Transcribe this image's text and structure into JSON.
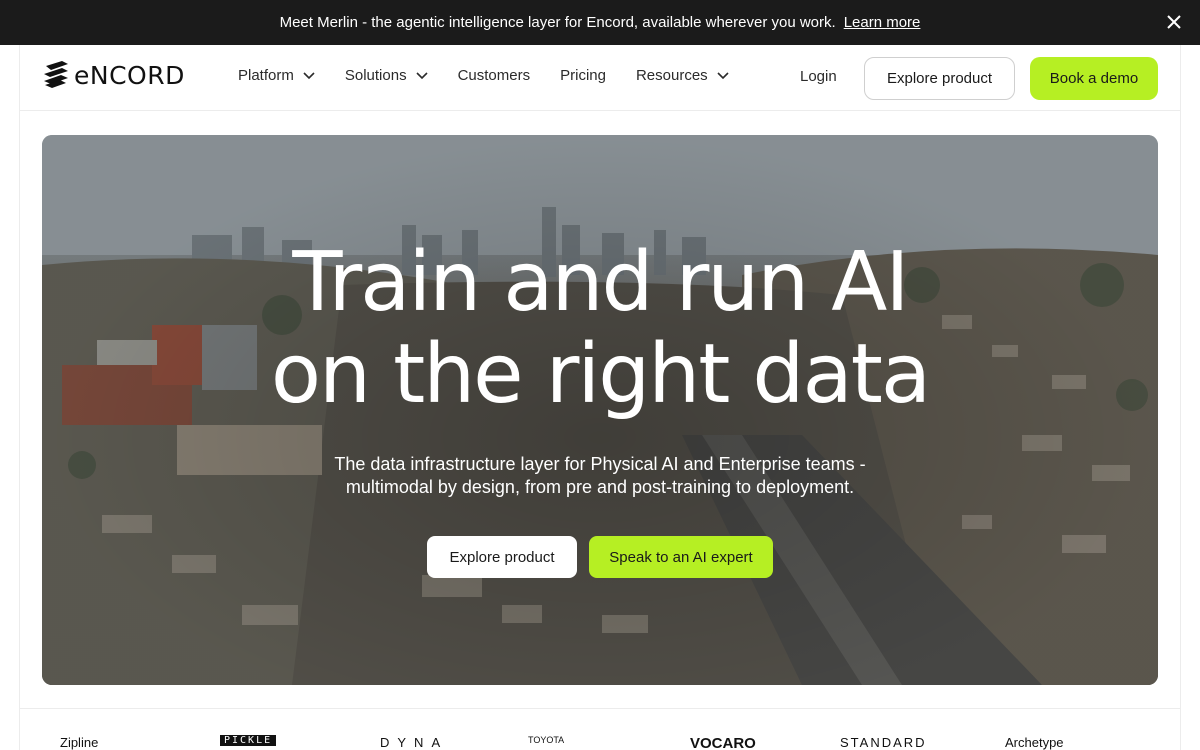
{
  "announcement": {
    "message": "Meet Merlin - the agentic intelligence layer for Encord, available wherever you work.",
    "link": "Learn more"
  },
  "nav": {
    "brand": "eNCORD",
    "menu": [
      {
        "label": "Platform",
        "dropdown": true
      },
      {
        "label": "Solutions",
        "dropdown": true
      },
      {
        "label": "Customers",
        "dropdown": false
      },
      {
        "label": "Pricing",
        "dropdown": false
      },
      {
        "label": "Resources",
        "dropdown": true
      }
    ],
    "login": "Login",
    "explore": "Explore product",
    "demo": "Book a demo"
  },
  "hero": {
    "title_line1": "Train and run AI",
    "title_line2": "on the right data",
    "subtitle_line1": "The data infrastructure layer for Physical AI and Enterprise teams -",
    "subtitle_line2": "multimodal by design, from pre and post-training to deployment.",
    "cta_primary": "Explore product",
    "cta_secondary": "Speak to an AI expert"
  },
  "logos": [
    "Zipline",
    "PICKLE",
    "DYNA",
    "TOYOTA",
    "VOCARO",
    "STANDARD",
    "Archetype"
  ],
  "colors": {
    "accent": "#b6ef23",
    "announce_bg": "#1b1b1b",
    "text": "#1a1a1a"
  }
}
